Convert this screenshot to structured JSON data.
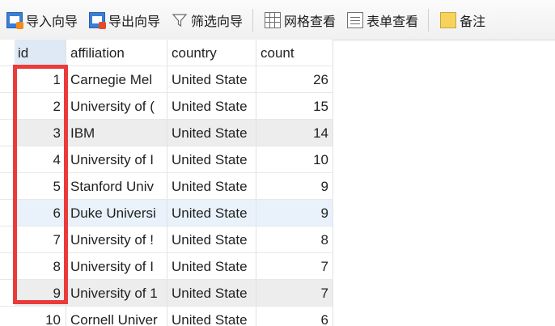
{
  "toolbar": {
    "import_label": "导入向导",
    "export_label": "导出向导",
    "filter_label": "筛选向导",
    "grid_view_label": "网格查看",
    "form_view_label": "表单查看",
    "note_label": "备注"
  },
  "table": {
    "columns": [
      "id",
      "affiliation",
      "country",
      "count"
    ],
    "rows": [
      {
        "id": "1",
        "affiliation": "Carnegie Mel",
        "country": "United State",
        "count": "26"
      },
      {
        "id": "2",
        "affiliation": "University of (",
        "country": "United State",
        "count": "15"
      },
      {
        "id": "3",
        "affiliation": "IBM",
        "country": "United State",
        "count": "14"
      },
      {
        "id": "4",
        "affiliation": "University of I",
        "country": "United State",
        "count": "10"
      },
      {
        "id": "5",
        "affiliation": "Stanford Univ",
        "country": "United State",
        "count": "9"
      },
      {
        "id": "6",
        "affiliation": "Duke Universi",
        "country": "United State",
        "count": "9"
      },
      {
        "id": "7",
        "affiliation": "University of !",
        "country": "United State",
        "count": "8"
      },
      {
        "id": "8",
        "affiliation": "University of I",
        "country": "United State",
        "count": "7"
      },
      {
        "id": "9",
        "affiliation": "University of 1",
        "country": "United State",
        "count": "7"
      },
      {
        "id": "10",
        "affiliation": "Cornell Univer",
        "country": "United State",
        "count": "6"
      }
    ]
  },
  "colors": {
    "highlight": "#ea3b3b",
    "header_selected": "#dfe9f6",
    "row_alt": "#ededed",
    "row_selected": "#e9f2fb"
  }
}
